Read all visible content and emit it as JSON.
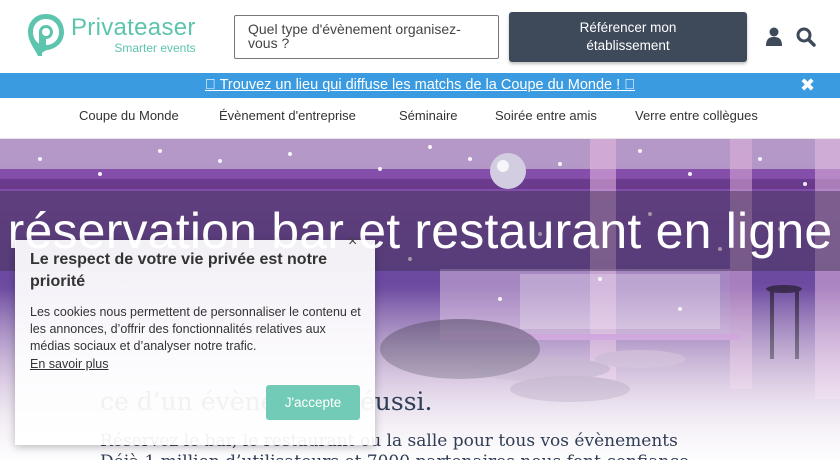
{
  "header": {
    "logo_name": "Privateaser",
    "logo_tagline": "Smarter events",
    "search_placeholder": "Quel type d'évènement organisez-vous ?",
    "cta_line1": "Référencer mon",
    "cta_line2": "établissement",
    "icons": [
      "user-icon",
      "search-icon",
      "logo-pin-icon"
    ]
  },
  "banner": {
    "text": "\u0000 Trouvez un lieu qui diffuse les matchs de la Coupe du Monde ! \u0000",
    "close_glyph": "✖",
    "background": "#3a9be0"
  },
  "nav": {
    "items": [
      {
        "label": "Coupe du Monde"
      },
      {
        "label": "Évènement d'entreprise"
      },
      {
        "label": "Séminaire"
      },
      {
        "label": "Soirée entre amis"
      },
      {
        "label": "Verre entre collègues"
      }
    ]
  },
  "hero": {
    "title": "réservation bar et restaurant en ligne",
    "subtitle_visible": "ce d’un évènement réussi.",
    "line2_visible": "Réservez le bar, le restaurant ou la salle pour tous vos évènements",
    "line3_visible": "Déjà 1 million d’utilisateurs et 7000 partenaires nous font confiance"
  },
  "cookie": {
    "close_glyph": "×",
    "title": "Le respect de votre vie privée est notre priorité",
    "text": "Les cookies nous permettent de personnaliser le contenu et les annonces, d’offrir des fonctionnalités relatives aux médias sociaux et d’analyser notre trafic.",
    "link": "En savoir plus",
    "accept": "J'accepte"
  },
  "colors": {
    "brand": "#5dc4ad",
    "cta": "#3e4a5a",
    "accept": "#72cbb6",
    "headline": "#2f3d55"
  }
}
